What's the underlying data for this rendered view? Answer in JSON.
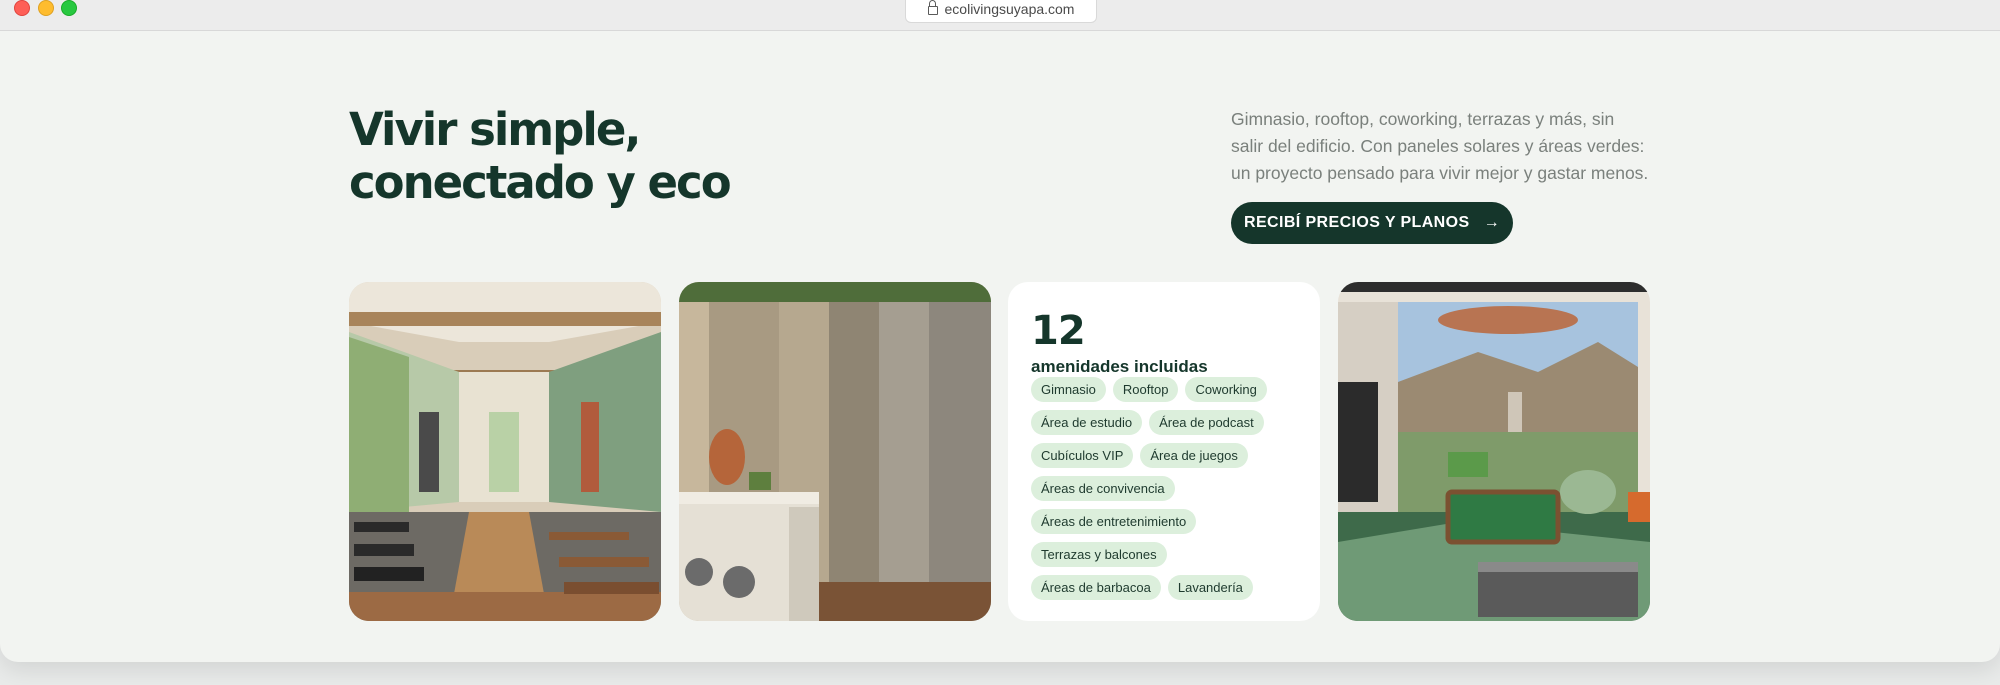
{
  "browser": {
    "url": "ecolivingsuyapa.com"
  },
  "hero": {
    "title_line1": "Vivir simple,",
    "title_line2": "conectado y eco",
    "description": "Gimnasio, rooftop, coworking, terrazas y más, sin salir del edificio. Con paneles solares y áreas verdes: un proyecto pensado para vivir mejor y gastar menos.",
    "cta_label": "RECIBÍ PRECIOS Y PLANOS",
    "cta_icon": "arrow-right-icon"
  },
  "amenities": {
    "count": "12",
    "label": "amenidades incluidas",
    "rows": [
      [
        "Gimnasio",
        "Rooftop",
        "Coworking"
      ],
      [
        "Área de estudio",
        "Área de podcast"
      ],
      [
        "Cubículos VIP",
        "Área de juegos"
      ],
      [
        "Áreas de convivencia"
      ],
      [
        "Áreas de entretenimiento"
      ],
      [
        "Terrazas y balcones"
      ],
      [
        "Áreas de barbacoa",
        "Lavandería"
      ]
    ]
  },
  "colors": {
    "brand_dark_green": "#15362b",
    "chip_bg": "#dcefdc",
    "page_bg": "#f2f4f1"
  }
}
